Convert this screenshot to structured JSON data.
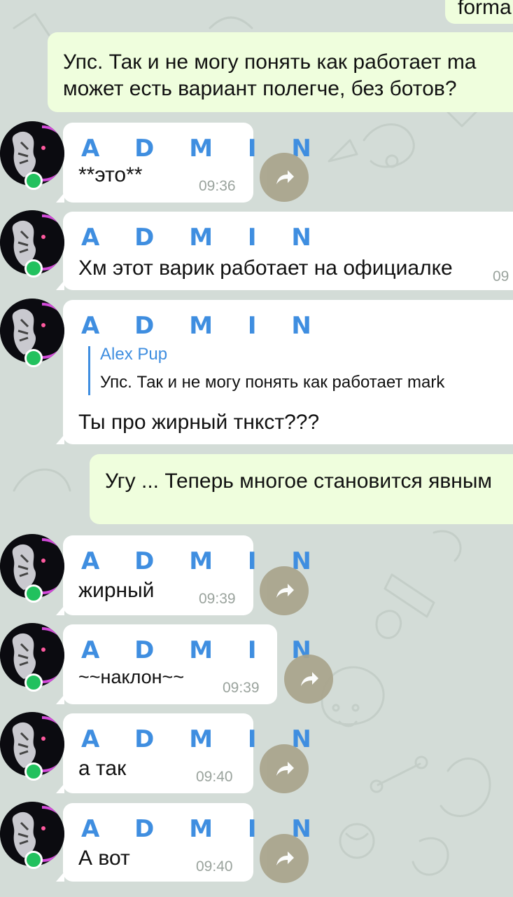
{
  "messages": [
    {
      "direction": "outgoing",
      "text_cut": "forma"
    },
    {
      "direction": "outgoing",
      "line1": "Упс. Так и не могу понять как работает ma",
      "line2": "может есть вариант полегче, без ботов?"
    },
    {
      "direction": "incoming",
      "sender": "A D M I N",
      "text": "**это**",
      "time": "09:36"
    },
    {
      "direction": "incoming",
      "sender": "A D M I N",
      "text": "Хм этот варик работает на официалке",
      "time": "09"
    },
    {
      "direction": "incoming",
      "sender": "A D M I N",
      "reply_to_name": "Alex Pup",
      "reply_to_text": "Упс. Так и не могу понять как работает mark",
      "text": "Ты про жирный тнкст???"
    },
    {
      "direction": "outgoing",
      "text": "Угу ... Теперь многое становится явным"
    },
    {
      "direction": "incoming",
      "sender": "A D M I N",
      "text": "жирный",
      "time": "09:39"
    },
    {
      "direction": "incoming",
      "sender": "A D M I N",
      "text": "~~наклон~~",
      "time": "09:39"
    },
    {
      "direction": "incoming",
      "sender": "A D M I N",
      "text": "а так",
      "time": "09:40"
    },
    {
      "direction": "incoming",
      "sender": "A D M I N",
      "text": "А вот",
      "time": "09:40"
    }
  ],
  "colors": {
    "background": "#d3dcd7",
    "incoming_bubble": "#ffffff",
    "outgoing_bubble": "#effedd",
    "sender_name": "#3f8ee0",
    "online_dot": "#22c15e",
    "forward_button": "#a9a48c"
  },
  "icons": {
    "forward": "share-arrow-icon",
    "avatar": "profile-avatar",
    "status": "online-status-dot"
  }
}
